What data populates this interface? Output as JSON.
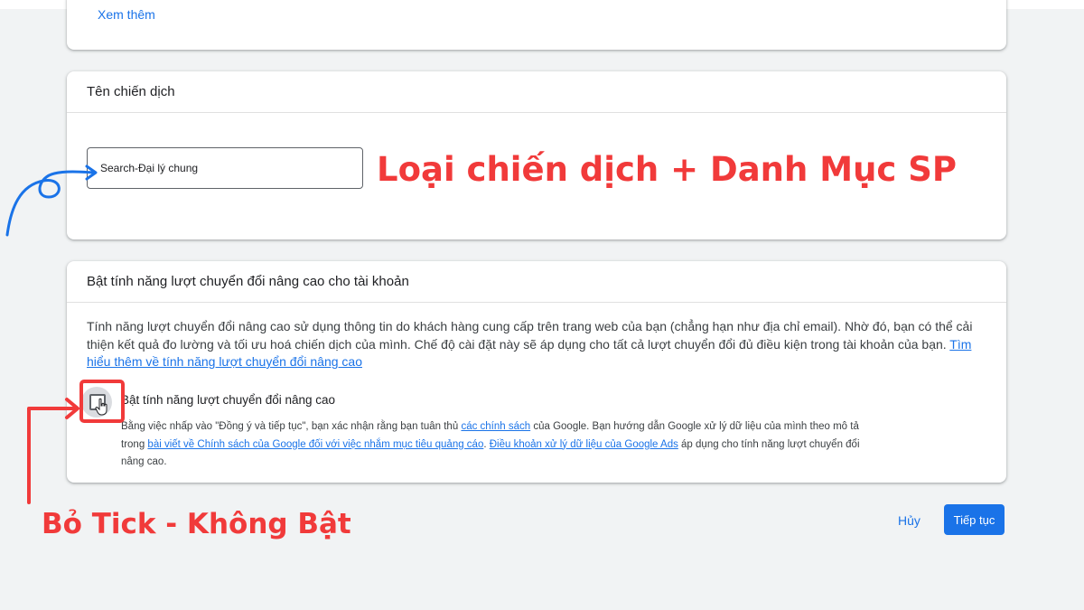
{
  "top_card": {
    "see_more": "Xem thêm"
  },
  "campaign_name": {
    "title": "Tên chiến dịch",
    "input_value": "Search-Đại lý chung"
  },
  "enhanced_conversions": {
    "title": "Bật tính năng lượt chuyển đổi nâng cao cho tài khoản",
    "description": "Tính năng lượt chuyển đổi nâng cao sử dụng thông tin do khách hàng cung cấp trên trang web của bạn (chẳng hạn như địa chỉ email). Nhờ đó, bạn có thể cải thiện kết quả đo lường và tối ưu hoá chiến dịch của mình. Chế độ cài đặt này sẽ áp dụng cho tất cả lượt chuyển đổi đủ điều kiện trong tài khoản của bạn.",
    "learn_more": "Tìm hiểu thêm về tính năng lượt chuyển đổi nâng cao",
    "checkbox_label": "Bật tính năng lượt chuyển đổi nâng cao",
    "checkbox_checked": false,
    "consent": {
      "t1": "Bằng việc nhấp vào \"Đồng ý và tiếp tục\", bạn xác nhận rằng bạn tuân thủ ",
      "link1": "các chính sách",
      "t2": " của Google. Bạn hướng dẫn Google xử lý dữ liệu của mình theo mô tả trong ",
      "link2": "bài viết về Chính sách của Google đối với việc nhắm mục tiêu quảng cáo",
      "t3": ". ",
      "link3": "Điều khoản xử lý dữ liệu của Google Ads",
      "t4": " áp dụng cho tính năng lượt chuyển đổi nâng cao."
    }
  },
  "actions": {
    "cancel": "Hủy",
    "continue": "Tiếp tục"
  },
  "annotations": {
    "campaign_note": "Loại chiến dịch + Danh Mục SP",
    "checkbox_note": "Bỏ Tick - Không Bật"
  },
  "colors": {
    "accent": "#1a73e8",
    "annotation_red": "#f13a3a",
    "annotation_blue": "#1a73e8"
  }
}
